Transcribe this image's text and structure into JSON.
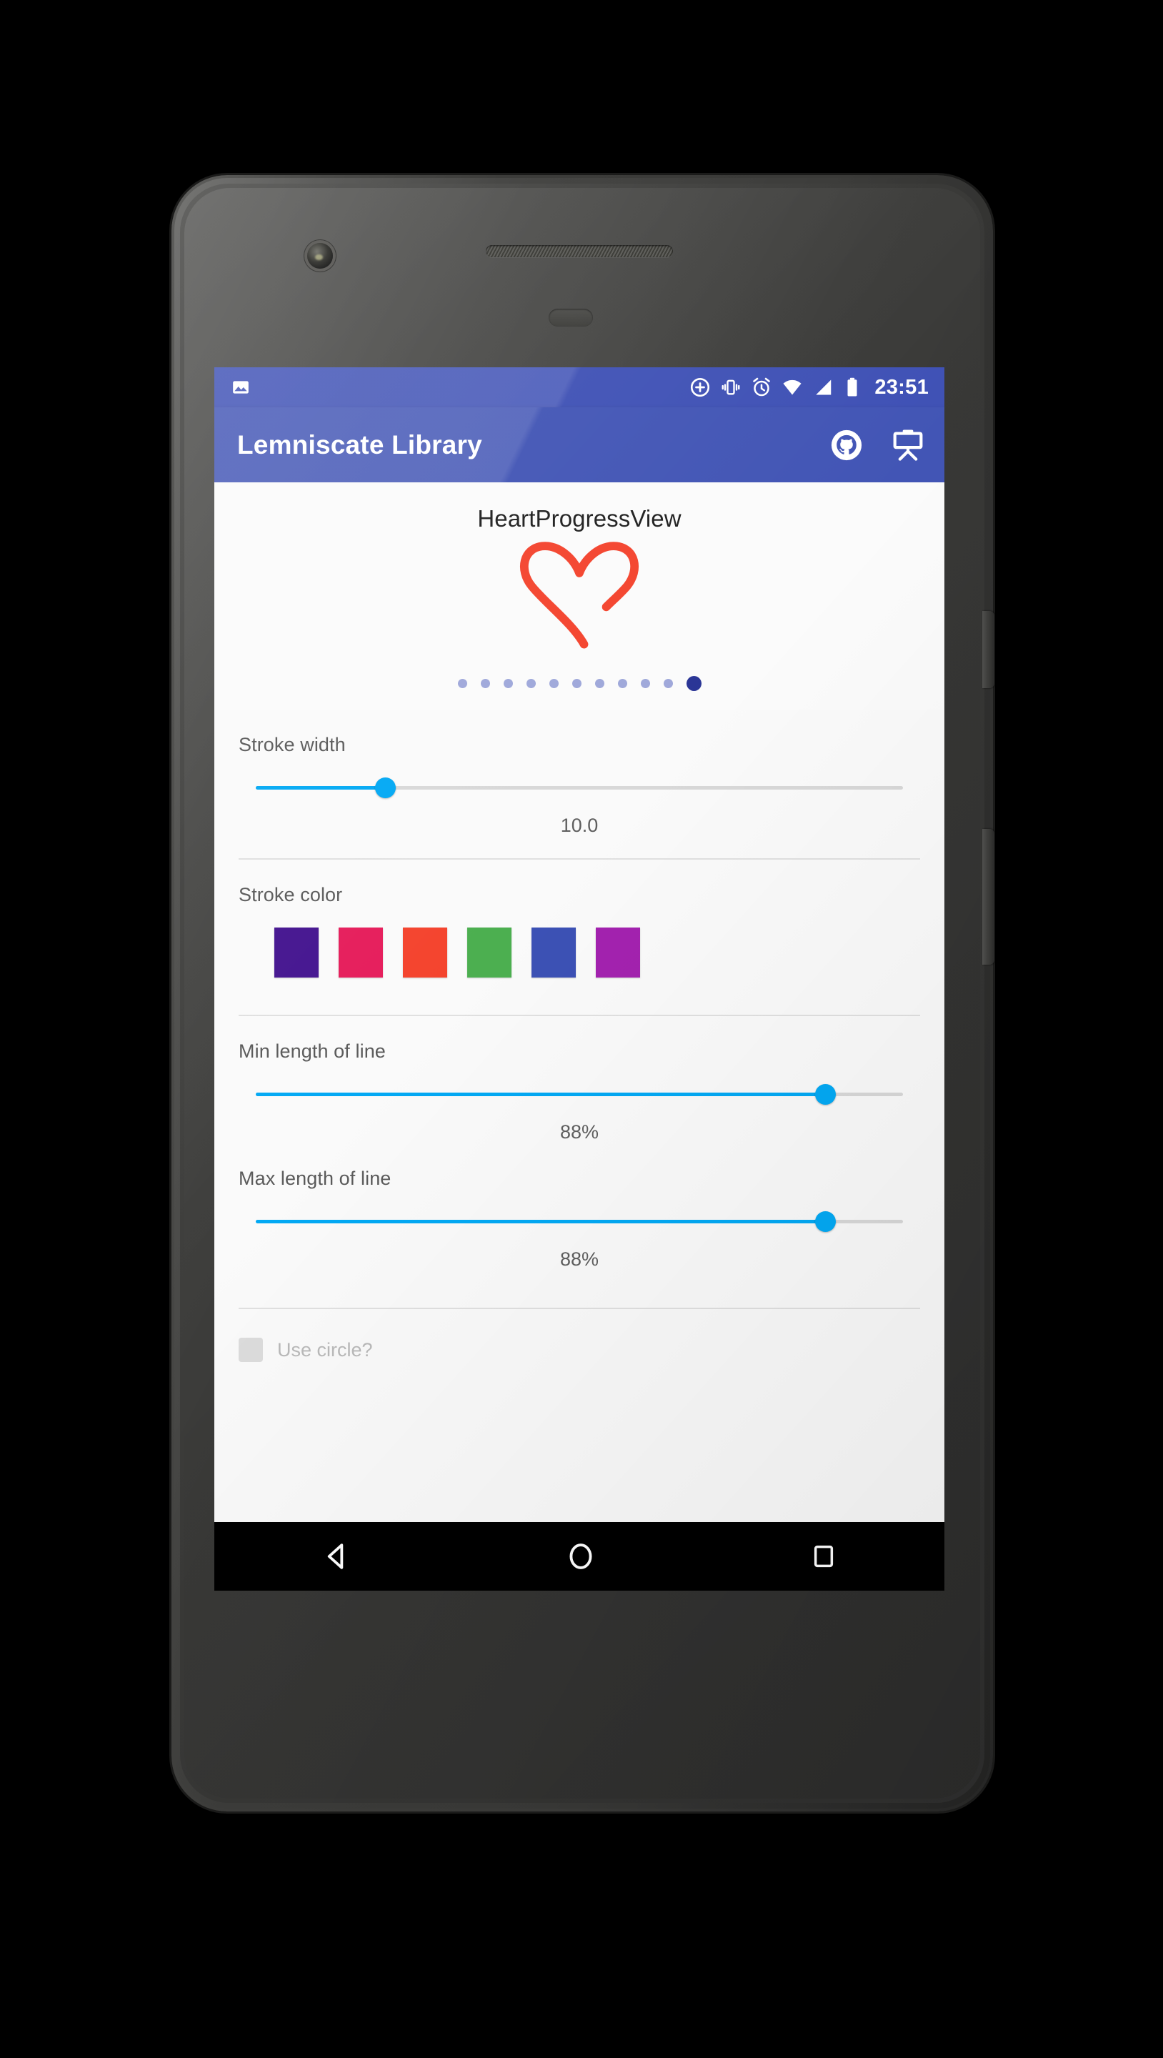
{
  "status_bar": {
    "time": "23:51",
    "notification_icon": "image-icon",
    "icons": [
      "add-circle-icon",
      "vibrate-icon",
      "alarm-icon",
      "wifi-icon",
      "signal-icon",
      "battery-icon"
    ],
    "background_color": "#3f51b5"
  },
  "app_bar": {
    "title": "Lemniscate Library",
    "background_color": "#4255b5",
    "actions": [
      {
        "name": "github-icon",
        "label": "GitHub"
      },
      {
        "name": "presentation-icon",
        "label": "Presentation"
      }
    ]
  },
  "preview": {
    "title": "HeartProgressView",
    "shape": "heart",
    "stroke_color": "#F4442E",
    "background_color": "#fbfbfb",
    "pager": {
      "total_dots": 11,
      "active_index": 10,
      "inactive_color": "#9fa8da",
      "active_color": "#2a3596"
    }
  },
  "settings": {
    "stroke_width": {
      "label": "Stroke width",
      "value_text": "10.0",
      "percent": 20,
      "track_color": "#d8d8d8",
      "fill_color": "#03a9f4"
    },
    "stroke_color": {
      "label": "Stroke color",
      "swatches": [
        {
          "name": "swatch-deep-purple",
          "hex": "#451590"
        },
        {
          "name": "swatch-pink",
          "hex": "#E61E5C"
        },
        {
          "name": "swatch-red",
          "hex": "#F4442E"
        },
        {
          "name": "swatch-green",
          "hex": "#4CAF50"
        },
        {
          "name": "swatch-indigo",
          "hex": "#3C51B5"
        },
        {
          "name": "swatch-magenta",
          "hex": "#A322AF"
        }
      ]
    },
    "min_length": {
      "label": "Min length of line",
      "value_text": "88%",
      "percent": 88
    },
    "max_length": {
      "label": "Max length of line",
      "value_text": "88%",
      "percent": 88
    },
    "bottom_option": {
      "label": "Use circle?",
      "checked": false
    }
  },
  "nav_bar": {
    "buttons": [
      {
        "name": "nav-back-button",
        "label": "Back"
      },
      {
        "name": "nav-home-button",
        "label": "Home"
      },
      {
        "name": "nav-recents-button",
        "label": "Recents"
      }
    ]
  }
}
